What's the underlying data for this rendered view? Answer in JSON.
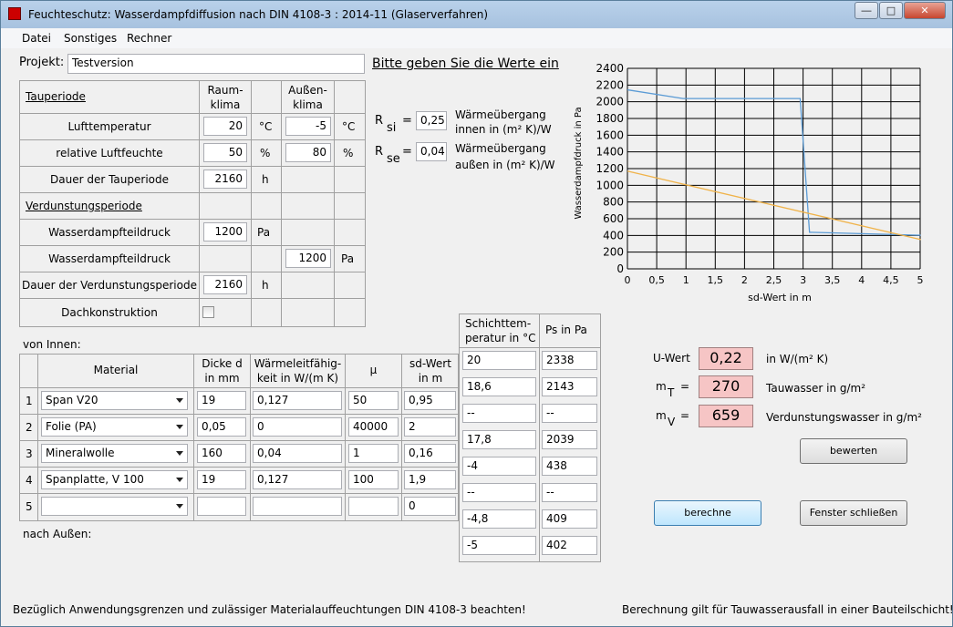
{
  "window": {
    "title": "Feuchteschutz: Wasserdampfdiffusion nach DIN 4108-3 : 2014-11 (Glaserverfahren)",
    "min": "―",
    "max": "□",
    "close": "✕"
  },
  "menu": [
    "Datei",
    "Sonstiges",
    "Rechner"
  ],
  "projekt": {
    "label": "Projekt:",
    "value": "Testversion",
    "hint": "Bitte geben Sie die Werte ein"
  },
  "klima": {
    "h_tau": "Tauperiode",
    "h_raum": "Raum-\nklima",
    "h_aussen": "Außen-\nklima",
    "rows": [
      {
        "label": "Lufttemperatur",
        "raum": "20",
        "unit1": "°C",
        "aussen": "-5",
        "unit2": "°C"
      },
      {
        "label": "relative Luftfeuchte",
        "raum": "50",
        "unit1": "%",
        "aussen": "80",
        "unit2": "%"
      },
      {
        "label": "Dauer der Tauperiode",
        "raum": "2160",
        "unit1": "h"
      }
    ],
    "h_verd": "Verdunstungsperiode",
    "verd_rows": [
      {
        "label": "Wasserdampfteildruck",
        "raum": "1200",
        "unit1": "Pa"
      },
      {
        "label": "Wasserdampfteildruck",
        "aussen": "1200",
        "unit2": "Pa"
      },
      {
        "label": "Dauer der Verdunstungsperiode",
        "raum": "2160",
        "unit1": "h"
      }
    ],
    "dach": "Dachkonstruktion"
  },
  "rsi": {
    "label": "R",
    "sub": "si",
    "eq": "=",
    "value": "0,25",
    "desc1": "Wärmeübergang",
    "desc2": "innen in (m² K)/W"
  },
  "rse": {
    "label": "R",
    "sub": "se",
    "eq": "=",
    "value": "0,04",
    "desc1": "Wärmeübergang",
    "desc2": "außen in (m² K)/W"
  },
  "layers": {
    "von_innen": "von Innen:",
    "nach_aussen": "nach Außen:",
    "headers": [
      "Material",
      "Dicke d\nin mm",
      "Wärmeleitfähig-\nkeit in W/(m K)",
      "µ",
      "sd-Wert\nin m"
    ],
    "rows": [
      {
        "nr": "1",
        "material": "Span V20",
        "d": "19",
        "lambda": "0,127",
        "mu": "50",
        "sd": "0,95"
      },
      {
        "nr": "2",
        "material": "Folie (PA)",
        "d": "0,05",
        "lambda": "0",
        "mu": "40000",
        "sd": "2"
      },
      {
        "nr": "3",
        "material": "Mineralwolle",
        "d": "160",
        "lambda": "0,04",
        "mu": "1",
        "sd": "0,16"
      },
      {
        "nr": "4",
        "material": "Spanplatte, V 100",
        "d": "19",
        "lambda": "0,127",
        "mu": "100",
        "sd": "1,9"
      },
      {
        "nr": "5",
        "material": "",
        "d": "",
        "lambda": "",
        "mu": "",
        "sd": "0"
      }
    ]
  },
  "schicht": {
    "h_temp": "Schichttem-\nperatur in °C",
    "h_ps": "Ps in Pa",
    "rows": [
      {
        "t": "20",
        "ps": "2338"
      },
      {
        "t": "18,6",
        "ps": "2143"
      },
      {
        "t": "--",
        "ps": "--"
      },
      {
        "t": "17,8",
        "ps": "2039"
      },
      {
        "t": "-4",
        "ps": "438"
      },
      {
        "t": "--",
        "ps": "--"
      },
      {
        "t": "-4,8",
        "ps": "409"
      },
      {
        "t": "-5",
        "ps": "402"
      }
    ]
  },
  "results": {
    "u_label": "U-Wert",
    "u_value": "0,22",
    "u_unit": "in W/(m² K)",
    "mt_label": "m",
    "mt_sub": "T",
    "mt_eq": "=",
    "mt_value": "270",
    "mt_unit": "Tauwasser in g/m²",
    "mv_label": "m",
    "mv_sub": "V",
    "mv_eq": "=",
    "mv_value": "659",
    "mv_unit": "Verdunstungswasser in g/m²"
  },
  "buttons": {
    "bewerten": "bewerten",
    "berechne": "berechne",
    "schliessen": "Fenster schließen"
  },
  "footer": {
    "left": "Bezüglich Anwendungsgrenzen und zulässiger Materialauffeuchtungen DIN 4108-3 beachten!",
    "right": "Berechnung gilt für Tauwasserausfall in einer Bauteilschicht!"
  },
  "chart_data": {
    "type": "line",
    "xlabel": "sd-Wert in m",
    "ylabel": "Wasserdampfdruck in Pa",
    "xlim": [
      0,
      5
    ],
    "ylim": [
      0,
      2400
    ],
    "xticks": [
      "0",
      "0,5",
      "1",
      "1,5",
      "2",
      "2,5",
      "3",
      "3,5",
      "4",
      "4,5",
      "5"
    ],
    "yticks": [
      "0",
      "200",
      "400",
      "600",
      "800",
      "1000",
      "1200",
      "1400",
      "1600",
      "1800",
      "2000",
      "2200",
      "2400"
    ],
    "grid": true,
    "series": [
      {
        "color": "#5b9bd5",
        "x": [
          0,
          0.95,
          2.95,
          3.11,
          5.01
        ],
        "y": [
          2143,
          2039,
          2039,
          438,
          402
        ]
      },
      {
        "color": "#f0b34a",
        "x": [
          0,
          5.01
        ],
        "y": [
          1170,
          350
        ]
      }
    ]
  }
}
